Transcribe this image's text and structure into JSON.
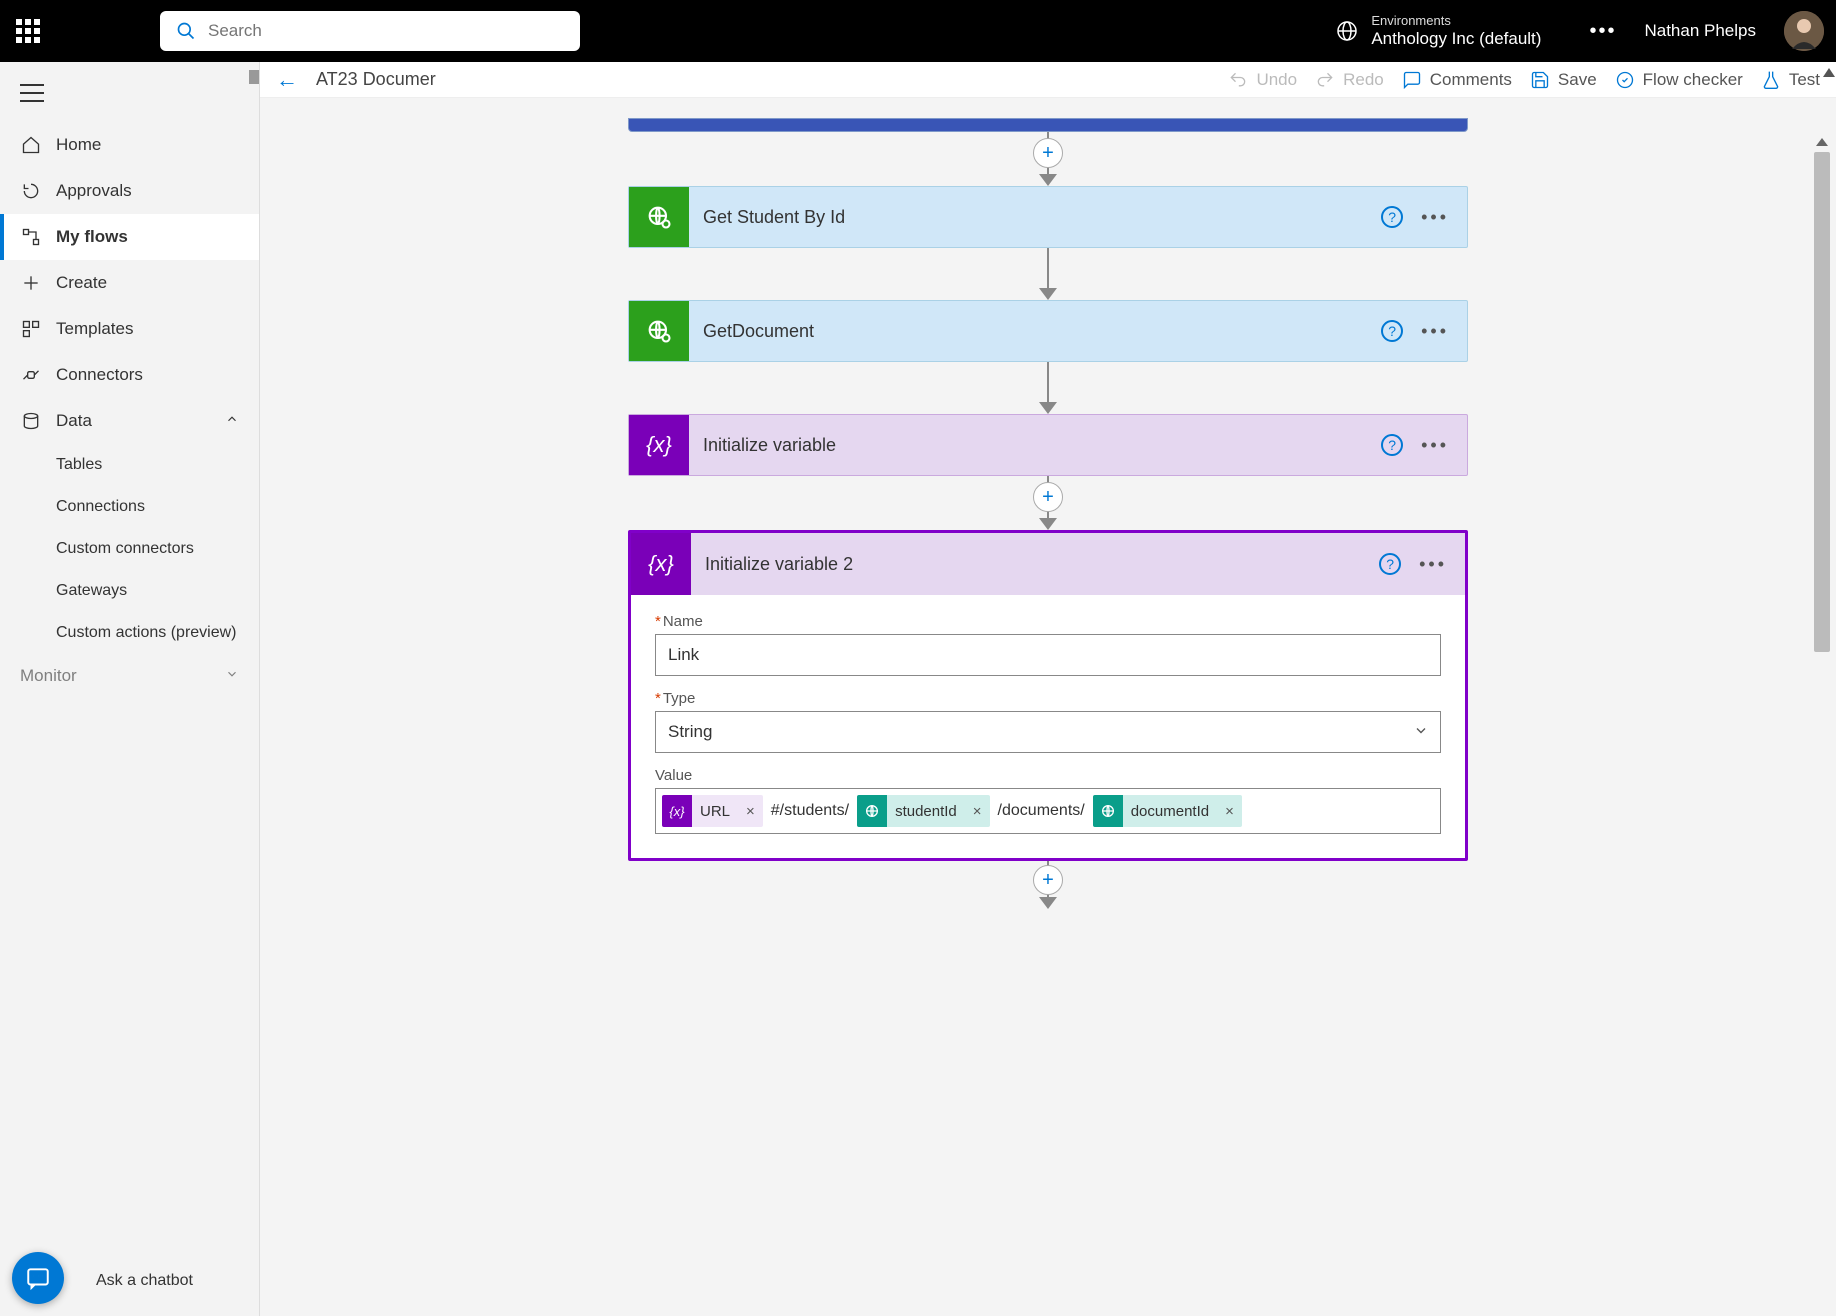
{
  "topbar": {
    "search_placeholder": "Search",
    "env_label": "Environments",
    "env_name": "Anthology Inc (default)",
    "user_name": "Nathan Phelps"
  },
  "sidebar": {
    "items": [
      {
        "icon": "home",
        "label": "Home"
      },
      {
        "icon": "approvals",
        "label": "Approvals"
      },
      {
        "icon": "flows",
        "label": "My flows",
        "active": true
      },
      {
        "icon": "plus",
        "label": "Create"
      },
      {
        "icon": "templates",
        "label": "Templates"
      },
      {
        "icon": "connectors",
        "label": "Connectors"
      },
      {
        "icon": "data",
        "label": "Data",
        "expandable": true,
        "expanded": true
      },
      {
        "icon": "monitor",
        "label": "Monitor",
        "expandable": true
      }
    ],
    "data_subitems": [
      {
        "label": "Tables"
      },
      {
        "label": "Connections"
      },
      {
        "label": "Custom connectors"
      },
      {
        "label": "Gateways"
      },
      {
        "label": "Custom actions (preview)"
      }
    ],
    "ask_chatbot": "Ask a chatbot"
  },
  "cmdbar": {
    "flow_title": "AT23 Documer",
    "undo": "Undo",
    "redo": "Redo",
    "comments": "Comments",
    "save": "Save",
    "flow_checker": "Flow checker",
    "test": "Test"
  },
  "steps": {
    "s1": "Get Student By Id",
    "s2": "GetDocument",
    "s3": "Initialize variable",
    "s4": "Initialize variable 2"
  },
  "form": {
    "name_label": "Name",
    "name_value": "Link",
    "type_label": "Type",
    "type_value": "String",
    "value_label": "Value",
    "tokens": {
      "url": "URL",
      "path1": "#/students/",
      "studentId": "studentId",
      "path2": "/documents/",
      "documentId": "documentId"
    }
  }
}
